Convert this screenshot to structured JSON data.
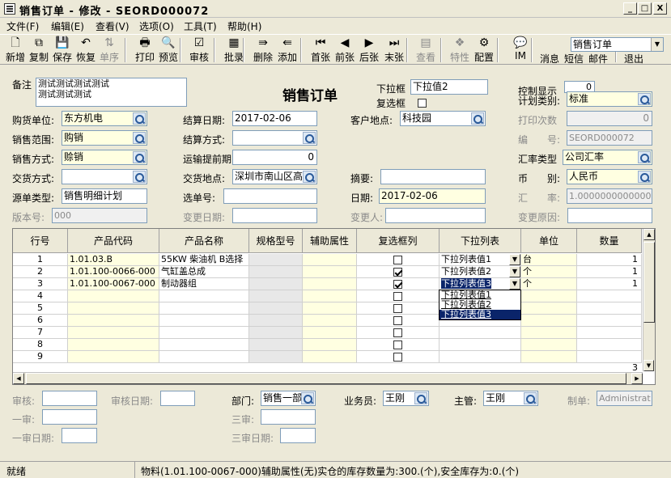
{
  "window": {
    "title": "销售订单 - 修改 - SEORD000072",
    "min": "_",
    "max": "□",
    "close": "X"
  },
  "menu": [
    "文件(F)",
    "编辑(E)",
    "查看(V)",
    "选项(O)",
    "工具(T)",
    "帮助(H)"
  ],
  "toolbar": {
    "buttons": [
      {
        "label": "新增",
        "icon": "new-icon",
        "glyph": "🗋"
      },
      {
        "label": "复制",
        "icon": "copy-icon",
        "glyph": "⧉"
      },
      {
        "label": "保存",
        "icon": "save-icon",
        "glyph": "💾"
      },
      {
        "label": "恢复",
        "icon": "undo-icon",
        "glyph": "↶"
      },
      {
        "label": "单序",
        "icon": "sort-icon",
        "glyph": "⇅",
        "disabled": true
      },
      {
        "label": "打印",
        "icon": "print-icon",
        "glyph": "🖶"
      },
      {
        "label": "预览",
        "icon": "preview-icon",
        "glyph": "🔍"
      },
      {
        "label": "审核",
        "icon": "audit-icon",
        "glyph": "☑"
      },
      {
        "label": "批录",
        "icon": "batch-icon",
        "glyph": "▦"
      },
      {
        "label": "删除",
        "icon": "delete-icon",
        "glyph": "⇛"
      },
      {
        "label": "添加",
        "icon": "add-icon",
        "glyph": "⇚"
      },
      {
        "label": "首张",
        "icon": "first-icon",
        "glyph": "⏮"
      },
      {
        "label": "前张",
        "icon": "prev-icon",
        "glyph": "◀"
      },
      {
        "label": "后张",
        "icon": "next-icon",
        "glyph": "▶"
      },
      {
        "label": "末张",
        "icon": "last-icon",
        "glyph": "⏭"
      },
      {
        "label": "查看",
        "icon": "view-icon",
        "glyph": "▤",
        "disabled": true
      },
      {
        "label": "特性",
        "icon": "feature-icon",
        "glyph": "❖",
        "disabled": true
      },
      {
        "label": "配置",
        "icon": "config-icon",
        "glyph": "⚙"
      },
      {
        "label": "IM",
        "icon": "im-icon",
        "glyph": "💬"
      },
      {
        "label": "消息",
        "icon": "message-icon",
        "glyph": "✉"
      },
      {
        "label": "短信",
        "icon": "sms-icon",
        "glyph": ""
      },
      {
        "label": "邮件",
        "icon": "mail-icon",
        "glyph": ""
      },
      {
        "label": "退出",
        "icon": "exit-icon",
        "glyph": ""
      }
    ],
    "doc_type_select": "销售订单"
  },
  "form": {
    "title": "销售订单",
    "remark_label": "备注",
    "remark": "测试测试测试测试\n测试测试测试",
    "dropdown_label": "下拉框",
    "dropdown_value": "下拉值2",
    "checkbox_label": "复选框",
    "control_display_label": "控制显示",
    "control_display_value": "0",
    "plan_type_label": "计划类别:",
    "plan_type_value": "标准",
    "buy_unit_label": "购货单位:",
    "buy_unit_value": "东方机电",
    "settle_date_label": "结算日期:",
    "settle_date_value": "2017-02-06",
    "cust_place_label": "客户地点:",
    "cust_place_value": "科技园",
    "print_count_label": "打印次数",
    "print_count_value": "0",
    "sales_scope_label": "销售范围:",
    "sales_scope_value": "购销",
    "settle_method_label": "结算方式:",
    "settle_method_value": "",
    "code_label": "编　　号:",
    "code_value": "SEORD000072",
    "sales_method_label": "销售方式:",
    "sales_method_value": "赊销",
    "ship_lead_label": "运输提前期:",
    "ship_lead_value": "0",
    "rate_type_label": "汇率类型",
    "rate_type_value": "公司汇率",
    "delivery_method_label": "交货方式:",
    "delivery_method_value": "",
    "delivery_place_label": "交货地点:",
    "delivery_place_value": "深圳市南山区高新",
    "summary_label": "摘要:",
    "summary_value": "",
    "currency_label": "币　　别:",
    "currency_value": "人民币",
    "source_type_label": "源单类型:",
    "source_type_value": "销售明细计划",
    "select_no_label": "选单号:",
    "select_no_value": "",
    "date_label": "日期:",
    "date_value": "2017-02-06",
    "rate_label": "汇　　率:",
    "rate_value": "1.0000000000000",
    "version_label": "版本号:",
    "version_value": "000",
    "change_date_label": "变更日期:",
    "change_date_value": "",
    "changer_label": "变更人:",
    "changer_value": "",
    "change_reason_label": "变更原因:",
    "change_reason_value": ""
  },
  "grid": {
    "headers": [
      "行号",
      "产品代码",
      "产品名称",
      "规格型号",
      "辅助属性",
      "复选框列",
      "下拉列表",
      "单位",
      "数量"
    ],
    "rows": [
      {
        "no": "1",
        "code": "1.01.03.B",
        "name": "55KW 柴油机  B选择",
        "chk": false,
        "dd": "下拉列表值1",
        "unit": "台",
        "qty": "1"
      },
      {
        "no": "2",
        "code": "1.01.100-0066-000",
        "name": "气缸盖总成",
        "chk": true,
        "dd": "下拉列表值2",
        "unit": "个",
        "qty": "1"
      },
      {
        "no": "3",
        "code": "1.01.100-0067-000",
        "name": "制动器组",
        "chk": true,
        "dd": "下拉列表值3",
        "unit": "个",
        "qty": "1"
      },
      {
        "no": "4",
        "code": "",
        "name": "",
        "chk": false,
        "dd": "",
        "unit": "",
        "qty": ""
      },
      {
        "no": "5",
        "code": "",
        "name": "",
        "chk": false,
        "dd": "",
        "unit": "",
        "qty": ""
      },
      {
        "no": "6",
        "code": "",
        "name": "",
        "chk": false,
        "dd": "",
        "unit": "",
        "qty": ""
      },
      {
        "no": "7",
        "code": "",
        "name": "",
        "chk": false,
        "dd": "",
        "unit": "",
        "qty": ""
      },
      {
        "no": "8",
        "code": "",
        "name": "",
        "chk": false,
        "dd": "",
        "unit": "",
        "qty": ""
      },
      {
        "no": "9",
        "code": "",
        "name": "",
        "chk": false,
        "dd": "",
        "unit": "",
        "qty": ""
      }
    ],
    "dropdown_options": [
      "下拉列表值1",
      "下拉列表值2",
      "下拉列表值3"
    ],
    "footer_total": "3"
  },
  "footer": {
    "audit_label": "审核:",
    "audit_date_label": "审核日期:",
    "first_audit_label": "一审:",
    "first_audit_date_label": "一审日期:",
    "dept_label": "部门:",
    "dept_value": "销售一部",
    "salesman_label": "业务员:",
    "salesman_value": "王刚",
    "manager_label": "主管:",
    "manager_value": "王刚",
    "maker_label": "制单:",
    "maker_value": "Administrat",
    "third_audit_label": "三审:",
    "third_audit_date_label": "三审日期:"
  },
  "status": {
    "left": "就绪",
    "message": "物料(1.01.100-0067-000)辅助属性(无)实仓的库存数量为:300.(个),安全库存为:0.(个)"
  }
}
